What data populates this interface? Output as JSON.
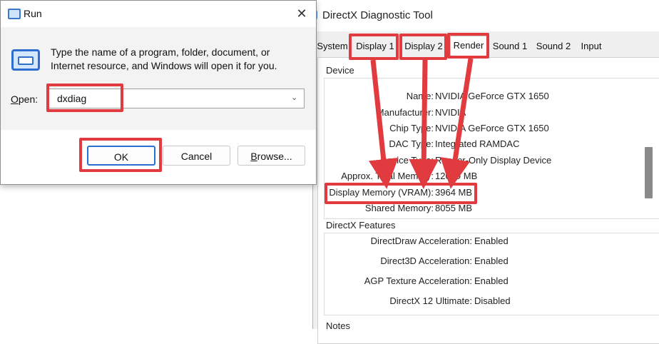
{
  "run_dialog": {
    "title": "Run",
    "close_glyph": "✕",
    "description": "Type the name of a program, folder, document, or Internet resource, and Windows will open it for you.",
    "open_label_first": "O",
    "open_label_rest": "pen:",
    "input_value": "dxdiag",
    "dropdown_glyph": "⌄",
    "ok_label": "OK",
    "cancel_label": "Cancel",
    "browse_first": "B",
    "browse_rest": "rowse..."
  },
  "dx": {
    "title": "DirectX Diagnostic Tool",
    "tabs": [
      "System",
      "Display 1",
      "Display 2",
      "Render",
      "Sound 1",
      "Sound 2",
      "Input"
    ],
    "active_tab": "Render",
    "device_group": "Device",
    "device_rows": [
      {
        "label": "Name:",
        "value": "NVIDIA GeForce GTX 1650"
      },
      {
        "label": "Manufacturer:",
        "value": "NVIDIA"
      },
      {
        "label": "Chip Type:",
        "value": "NVIDIA GeForce GTX 1650"
      },
      {
        "label": "DAC Type:",
        "value": "Integrated RAMDAC"
      },
      {
        "label": "Device Type:",
        "value": "Render-Only Display Device"
      },
      {
        "label": "Approx. Total Memory:",
        "value": "12019 MB"
      },
      {
        "label": "Display Memory (VRAM):",
        "value": "3964 MB"
      },
      {
        "label": "Shared Memory:",
        "value": "8055 MB"
      }
    ],
    "features_group": "DirectX Features",
    "feature_rows": [
      {
        "label": "DirectDraw Acceleration:",
        "value": "Enabled"
      },
      {
        "label": "Direct3D Acceleration:",
        "value": "Enabled"
      },
      {
        "label": "AGP Texture Acceleration:",
        "value": "Enabled"
      },
      {
        "label": "DirectX 12 Ultimate:",
        "value": "Disabled"
      }
    ],
    "notes_group": "Notes"
  },
  "colors": {
    "highlight": "#e23b3f",
    "accent": "#2a6fd6"
  }
}
